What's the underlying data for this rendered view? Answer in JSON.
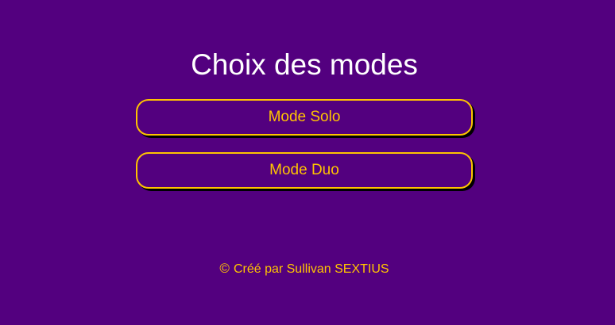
{
  "page": {
    "title": "Choix des modes"
  },
  "modes": {
    "solo_label": "Mode Solo",
    "duo_label": "Mode Duo"
  },
  "footer": {
    "copyright_symbol": "©",
    "credit": "Créé par Sullivan SEXTIUS"
  },
  "colors": {
    "background": "#53007f",
    "accent": "#ffc400",
    "title": "#ffffff",
    "shadow": "#000000"
  }
}
